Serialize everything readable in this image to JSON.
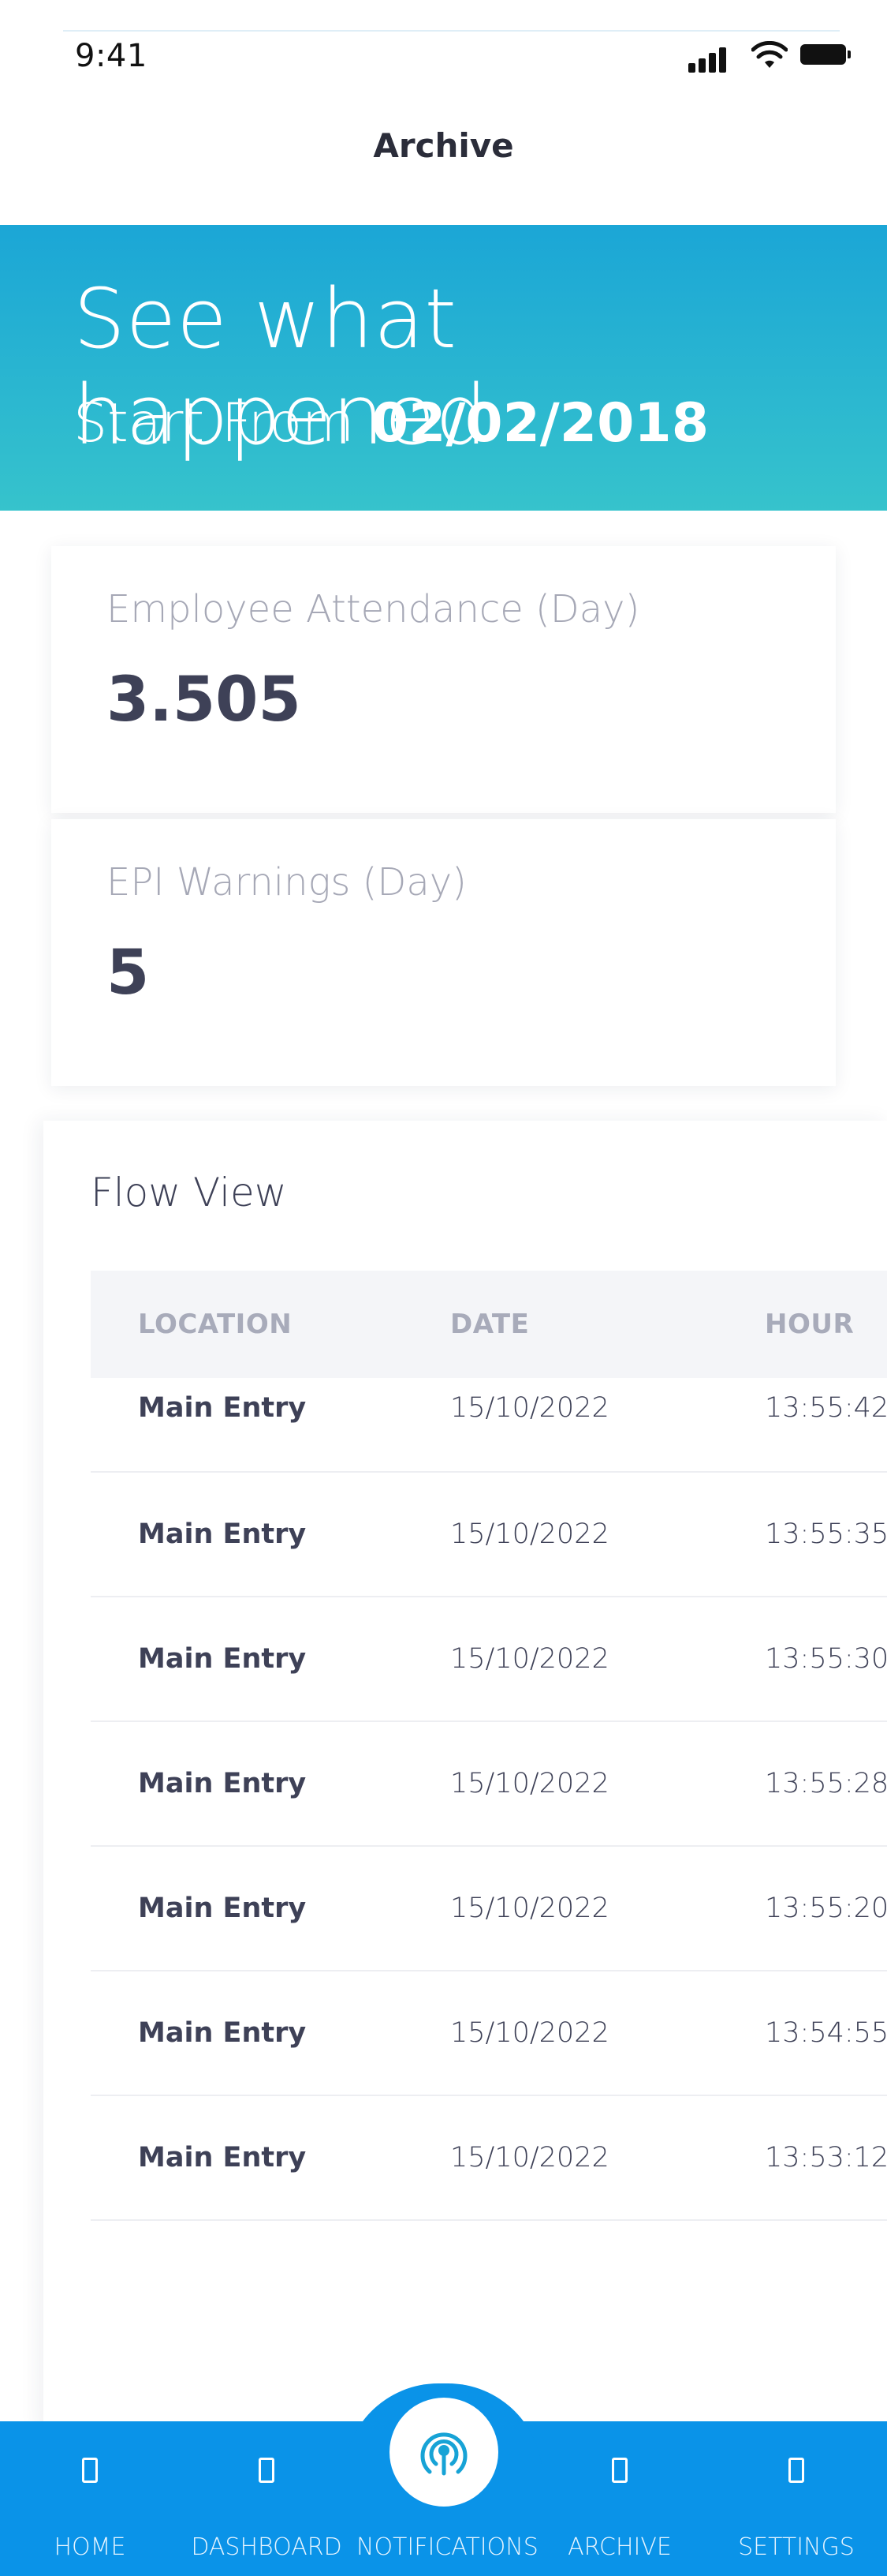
{
  "status_bar": {
    "time": "9:41"
  },
  "nav": {
    "title": "Archive"
  },
  "hero": {
    "headline": "See what happened",
    "subtitle_prefix": "Start From",
    "subtitle_date": "02/02/2018"
  },
  "stats": [
    {
      "label": "Employee Attendance (Day)",
      "value": "3.505"
    },
    {
      "label": "EPI Warnings (Day)",
      "value": "5"
    }
  ],
  "flow": {
    "title": "Flow View",
    "columns": [
      "LOCATION",
      "DATE",
      "HOUR"
    ],
    "rows": [
      {
        "location": "Main Entry",
        "date": "15/10/2022",
        "hour": "13:55:42"
      },
      {
        "location": "Main Entry",
        "date": "15/10/2022",
        "hour": "13:55:35"
      },
      {
        "location": "Main Entry",
        "date": "15/10/2022",
        "hour": "13:55:30"
      },
      {
        "location": "Main Entry",
        "date": "15/10/2022",
        "hour": "13:55:28"
      },
      {
        "location": "Main Entry",
        "date": "15/10/2022",
        "hour": "13:55:20"
      },
      {
        "location": "Main Entry",
        "date": "15/10/2022",
        "hour": "13:54:55"
      },
      {
        "location": "Main Entry",
        "date": "15/10/2022",
        "hour": "13:53:12"
      }
    ]
  },
  "tabbar": {
    "items": [
      {
        "label": "HOME",
        "icon": "home-icon"
      },
      {
        "label": "DASHBOARD",
        "icon": "dashboard-icon"
      },
      {
        "label": "NOTIFICATIONS",
        "icon": "broadcast-icon"
      },
      {
        "label": "ARCHIVE",
        "icon": "archive-icon"
      },
      {
        "label": "SETTINGS",
        "icon": "settings-icon"
      }
    ]
  },
  "colors": {
    "hero_gradient_top": "#1ba6d6",
    "hero_gradient_bottom": "#36c3cc",
    "tabbar": "#0a93e8",
    "text_primary": "#3e4157",
    "text_muted": "#a6a8b6"
  }
}
